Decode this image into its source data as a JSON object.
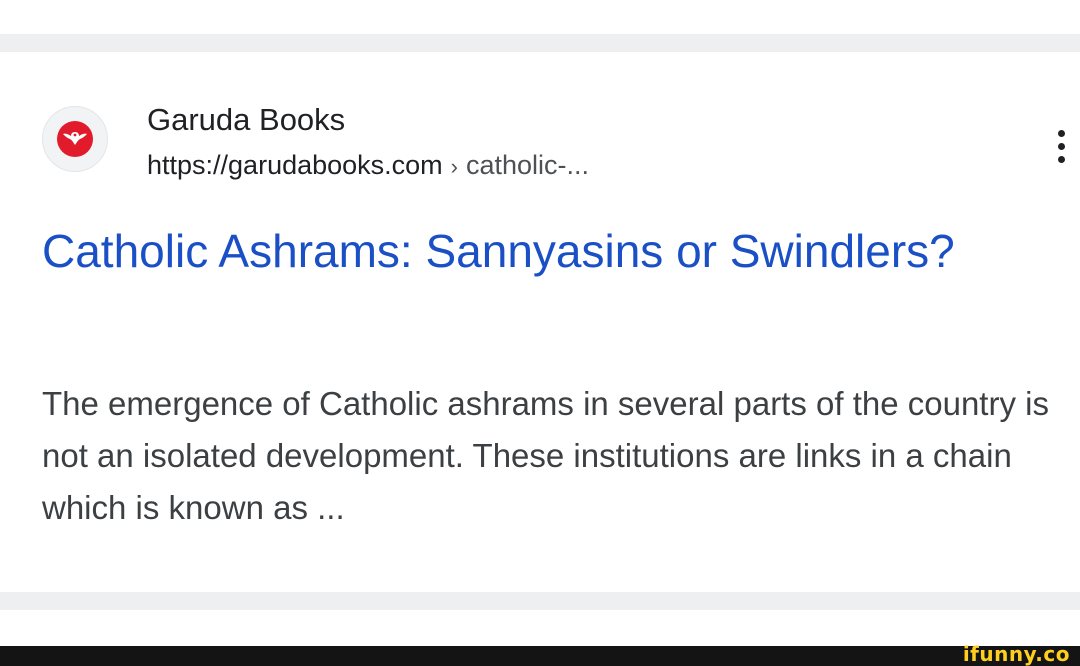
{
  "result": {
    "site_name": "Garuda Books",
    "url_host": "https://garudabooks.com",
    "url_separator": "›",
    "url_path": "catholic-...",
    "title": "Catholic Ashrams: Sannyasins or Swindlers?",
    "snippet": "The emergence of Catholic ashrams in several parts of the country is not an isolated development. These institutions are links in a chain which is known as ..."
  },
  "icons": {
    "favicon": "garuda-eagle-logo-icon",
    "menu": "more-vert-icon"
  },
  "colors": {
    "title_link": "#1a4fc6",
    "logo_red": "#e21b2c",
    "watermark": "#ffcf1f"
  },
  "watermark": {
    "text": "ifunny.co"
  }
}
